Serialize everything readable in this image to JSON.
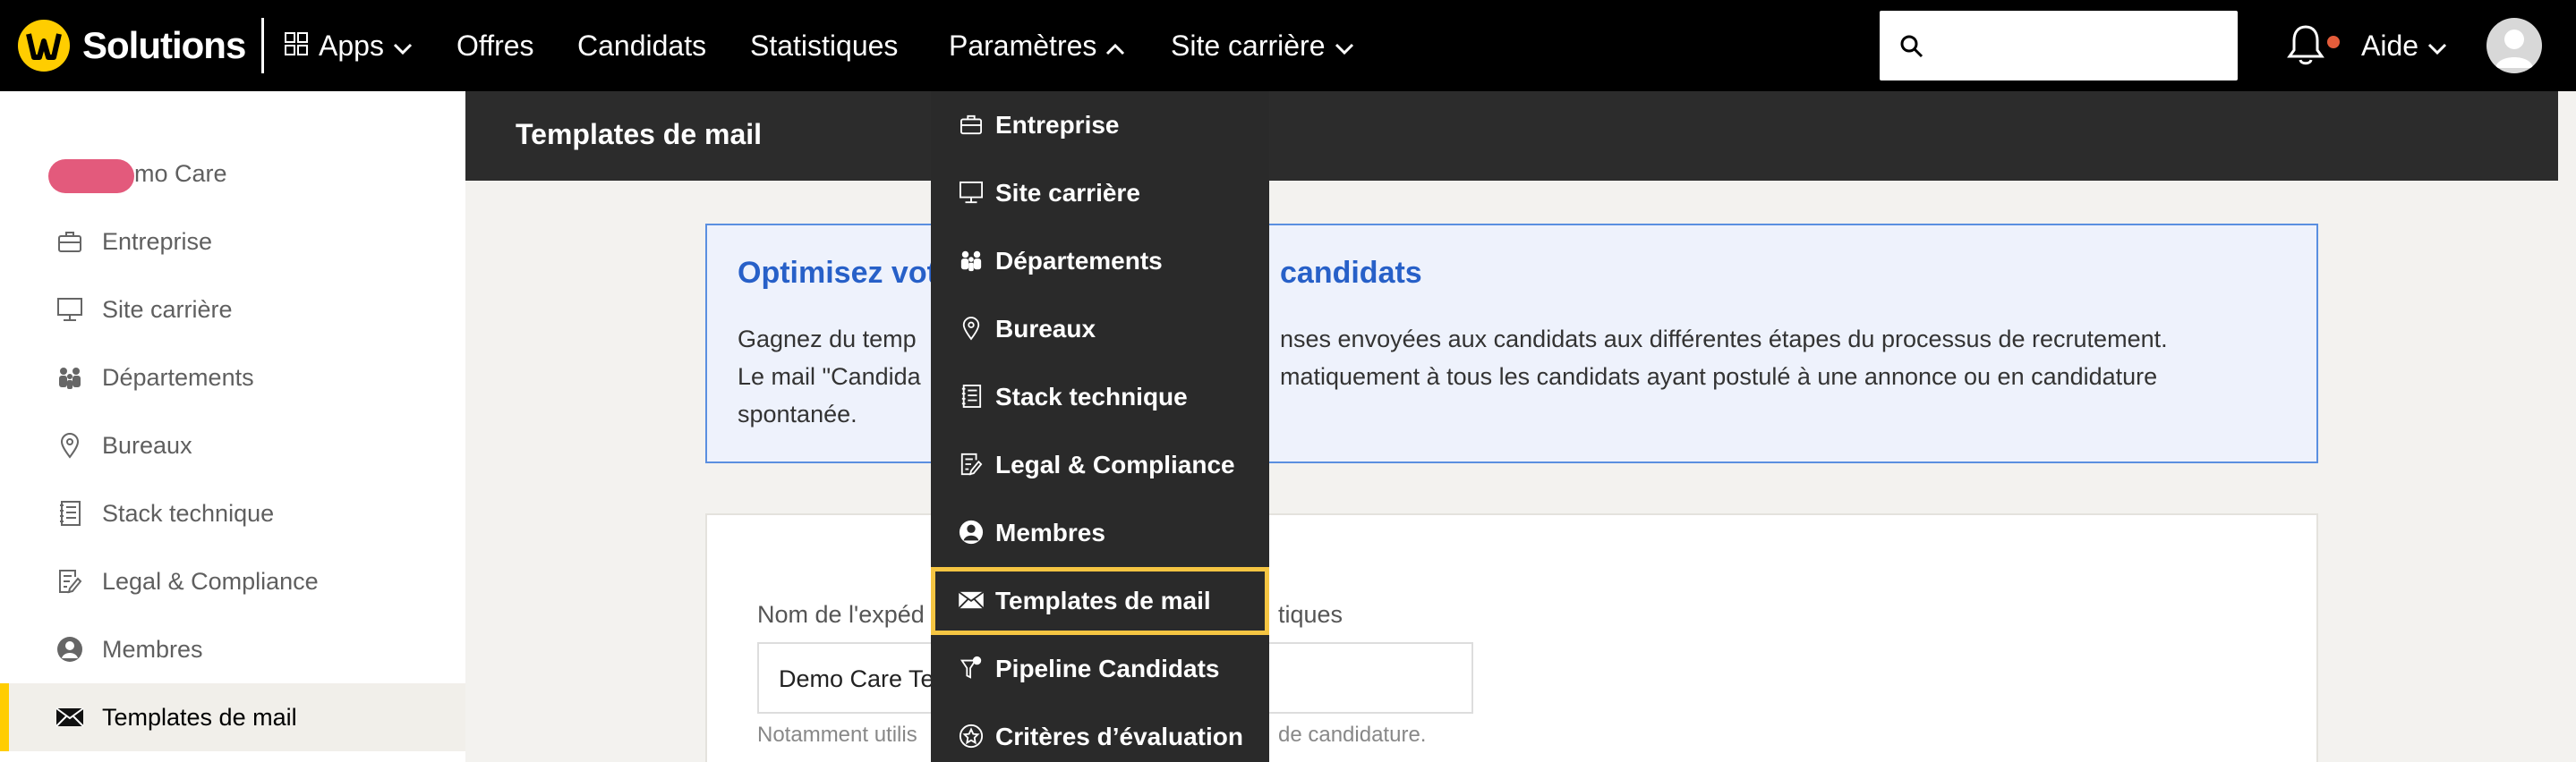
{
  "brand": {
    "name": "Solutions",
    "logo_mark": "W",
    "accent": "#ffcd00"
  },
  "nav": {
    "apps": "Apps",
    "offres": "Offres",
    "candidats": "Candidats",
    "statistiques": "Statistiques",
    "parametres": "Paramètres",
    "site_carriere": "Site carrière",
    "aide": "Aide"
  },
  "search": {
    "placeholder": "",
    "value": ""
  },
  "sidebar": {
    "company_suffix": "mo Care",
    "items": [
      {
        "label": "Entreprise",
        "icon": "briefcase-icon"
      },
      {
        "label": "Site carrière",
        "icon": "monitor-icon"
      },
      {
        "label": "Départements",
        "icon": "people-icon"
      },
      {
        "label": "Bureaux",
        "icon": "location-icon"
      },
      {
        "label": "Stack technique",
        "icon": "book-icon"
      },
      {
        "label": "Legal & Compliance",
        "icon": "document-pen-icon"
      },
      {
        "label": "Membres",
        "icon": "user-circle-icon"
      },
      {
        "label": "Templates de mail",
        "icon": "envelope-icon",
        "active": true
      }
    ]
  },
  "main": {
    "title": "Templates de mail",
    "info": {
      "heading_left": "Optimisez vot",
      "heading_right": "candidats",
      "line1_left": "Gagnez du temp",
      "line1_right": "nses envoyées aux candidats aux différentes étapes du processus de recrutement.",
      "line2_left": "Le mail \"Candida",
      "line2_right": "matiquement à tous les candidats ayant postulé à une annonce ou en candidature",
      "line3": "spontanée."
    },
    "form": {
      "sender_label_left": "Nom de l'expéd",
      "sender_label_right": "tiques",
      "sender_value": "Demo Care Te",
      "helper_left": "Notamment utilis",
      "helper_right": "de candidature."
    }
  },
  "dropdown": {
    "items": [
      {
        "label": "Entreprise",
        "icon": "briefcase-icon"
      },
      {
        "label": "Site carrière",
        "icon": "monitor-icon"
      },
      {
        "label": "Départements",
        "icon": "people-icon"
      },
      {
        "label": "Bureaux",
        "icon": "location-icon"
      },
      {
        "label": "Stack technique",
        "icon": "book-icon"
      },
      {
        "label": "Legal & Compliance",
        "icon": "document-pen-icon"
      },
      {
        "label": "Membres",
        "icon": "user-circle-icon"
      },
      {
        "label": "Templates de mail",
        "icon": "envelope-icon",
        "active": true
      },
      {
        "label": "Pipeline Candidats",
        "icon": "funnel-icon"
      },
      {
        "label": "Critères d’évaluation",
        "icon": "star-badge-icon"
      }
    ]
  },
  "colors": {
    "highlight": "#f5c542",
    "link_blue": "#2760c8",
    "notification": "#e45c3a"
  }
}
